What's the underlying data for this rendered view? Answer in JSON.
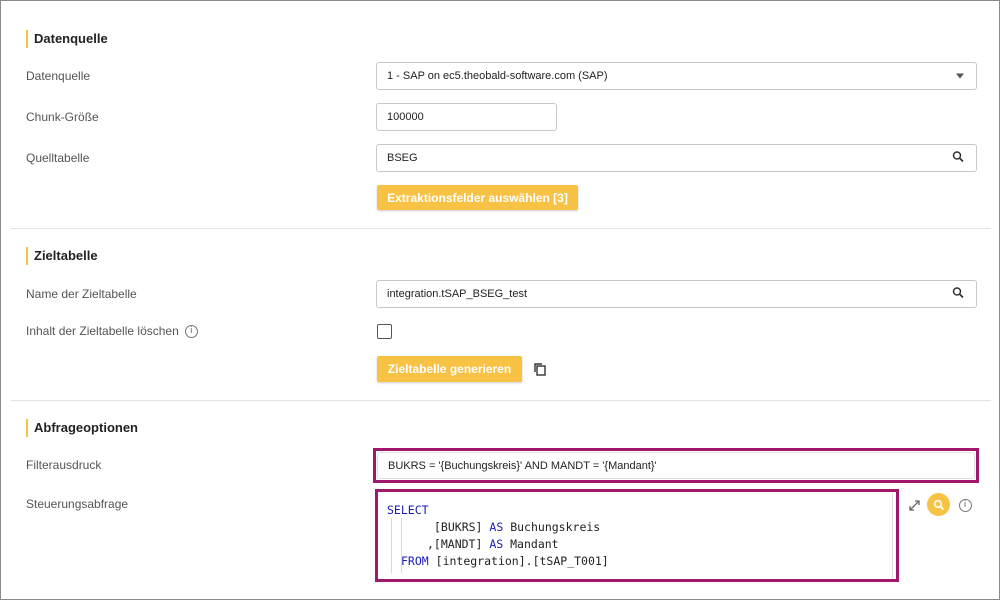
{
  "sections": {
    "datenquelle": {
      "title": "Datenquelle",
      "source_label": "Datenquelle",
      "source_value": "1 - SAP on ec5.theobald-software.com (SAP)",
      "chunk_label": "Chunk-Größe",
      "chunk_value": "100000",
      "table_label": "Quelltabelle",
      "table_value": "BSEG",
      "extract_button": "Extraktionsfelder auswählen [3]"
    },
    "zieltabelle": {
      "title": "Zieltabelle",
      "name_label": "Name der Zieltabelle",
      "name_value": "integration.tSAP_BSEG_test",
      "clear_label": "Inhalt der Zieltabelle löschen",
      "clear_checked": false,
      "generate_button": "Zieltabelle generieren"
    },
    "abfrage": {
      "title": "Abfrageoptionen",
      "filter_label": "Filterausdruck",
      "filter_value": "BUKRS = '{Buchungskreis}' AND MANDT = '{Mandant}'",
      "control_label": "Steuerungsabfrage",
      "code": {
        "kw_select": "SELECT",
        "l2_a": "[BUKRS]",
        "kw_as": "AS",
        "l2_b": "Buchungskreis",
        "l3_a": ",[MANDT]",
        "l3_b": "Mandant",
        "kw_from": "FROM",
        "l4_a": "[integration].[tSAP_T001]"
      }
    }
  },
  "icons": {
    "select_caret": "chevron-down-icon",
    "search": "search-icon",
    "info": "info-icon",
    "copy": "copy-icon",
    "expand": "expand-icon"
  },
  "colors": {
    "accent": "#f8c244",
    "highlight": "#a0186a",
    "keyword": "#1a1ab8"
  }
}
